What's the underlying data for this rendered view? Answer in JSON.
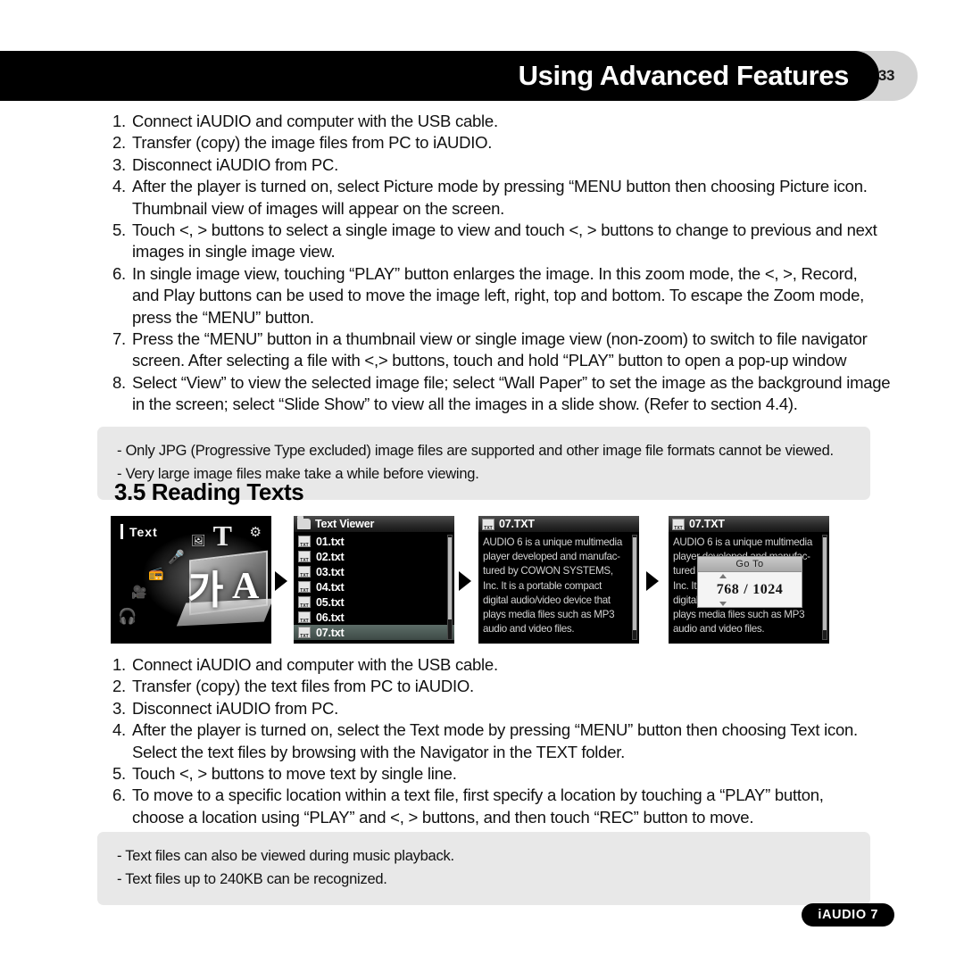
{
  "header": {
    "title": "Using Advanced Features",
    "page_number": "33"
  },
  "picture_steps": [
    {
      "num": "1.",
      "lines": [
        "Connect iAUDIO and computer with the USB cable."
      ]
    },
    {
      "num": "2.",
      "lines": [
        "Transfer (copy) the image files from PC to iAUDIO."
      ]
    },
    {
      "num": "3.",
      "lines": [
        "Disconnect iAUDIO from PC."
      ]
    },
    {
      "num": "4.",
      "lines": [
        "After the player is turned on, select Picture mode by pressing “MENU button then choosing Picture icon.",
        "Thumbnail view of images will appear on the screen."
      ]
    },
    {
      "num": "5.",
      "lines": [
        "Touch <, > buttons to select a single image to view and touch <, > buttons to change to previous and next",
        "images in single image view."
      ]
    },
    {
      "num": "6.",
      "lines": [
        "In single image view, touching “PLAY” button enlarges the image. In this zoom mode, the <, >, Record,",
        "and Play buttons can be used to move the image left, right, top and bottom. To escape the Zoom mode,",
        "press the “MENU” button."
      ]
    },
    {
      "num": "7.",
      "lines": [
        "Press the “MENU” button in a thumbnail view or single image view (non-zoom) to switch to file navigator",
        "screen. After selecting a file with <,> buttons, touch and hold “PLAY” button to open a pop-up window"
      ]
    },
    {
      "num": "8.",
      "lines": [
        "Select “View” to view the selected image file; select “Wall Paper” to set the image as the background image",
        "in the screen; select “Slide Show” to view all the images in a slide show. (Refer to section 4.4)."
      ]
    }
  ],
  "picture_notes": [
    "- Only JPG (Progressive Type excluded) image files are supported and other image file formats cannot be viewed.",
    "- Very large image files make take a while before viewing."
  ],
  "section": {
    "heading": "3.5 Reading Texts"
  },
  "screens": {
    "mode_menu": {
      "label": "Text",
      "icons": [
        "gear-icon",
        "big-t-icon",
        "picture-icon",
        "microphone-icon",
        "radio-icon",
        "camcorder-icon",
        "headphones-icon"
      ],
      "glyph_korean": "가",
      "glyph_latin": "A"
    },
    "file_browser": {
      "title": "Text Viewer",
      "files": [
        {
          "name": "01.txt",
          "selected": false
        },
        {
          "name": "02.txt",
          "selected": false
        },
        {
          "name": "03.txt",
          "selected": false
        },
        {
          "name": "04.txt",
          "selected": false
        },
        {
          "name": "05.txt",
          "selected": false
        },
        {
          "name": "06.txt",
          "selected": false
        },
        {
          "name": "07.txt",
          "selected": true
        }
      ]
    },
    "text_viewer": {
      "title": "07.TXT",
      "lines": [
        "AUDIO 6 is a unique multimedia",
        "player developed and manufac-",
        "tured by COWON SYSTEMS,",
        "Inc. It is a portable compact",
        "digital audio/video device that",
        "plays media files such as MP3",
        "audio and video files."
      ]
    },
    "text_viewer_goto": {
      "title": "07.TXT",
      "lines": [
        "AUDIO 6 is a unique multimedia",
        "player developed and manufac-",
        "tured                          MS,",
        "Inc. It                          t",
        "digital                        hat",
        "plays media files such as MP3",
        "audio and video files."
      ],
      "dialog": {
        "title": "Go To",
        "current": "768",
        "separator": "/",
        "total": "1024"
      }
    }
  },
  "text_steps": [
    {
      "num": "1.",
      "lines": [
        "Connect iAUDIO and computer with the USB cable."
      ]
    },
    {
      "num": "2.",
      "lines": [
        "Transfer (copy) the text files from PC to iAUDIO."
      ]
    },
    {
      "num": "3.",
      "lines": [
        "Disconnect iAUDIO from PC."
      ]
    },
    {
      "num": "4.",
      "lines": [
        "After the player is turned on, select the Text mode by pressing “MENU” button then choosing Text icon.",
        "Select the text files by browsing with the Navigator in the TEXT folder."
      ]
    },
    {
      "num": "5.",
      "lines": [
        "Touch <, > buttons to move text by single line."
      ]
    },
    {
      "num": "6.",
      "lines": [
        "To move to a specific location within a text file, first specify a location by touching a “PLAY” button,",
        "choose a location using “PLAY” and <, > buttons, and then touch “REC” button to move."
      ]
    }
  ],
  "text_notes": [
    "- Text files can also be viewed during music playback.",
    "- Text files up to 240KB can be recognized."
  ],
  "footer": {
    "product": "iAUDIO 7"
  },
  "colors": {
    "header_bar": "#000000",
    "page_pill": "#d4d4d4",
    "note_box": "#e8e8e8",
    "selected_row": "#4d5a56"
  }
}
